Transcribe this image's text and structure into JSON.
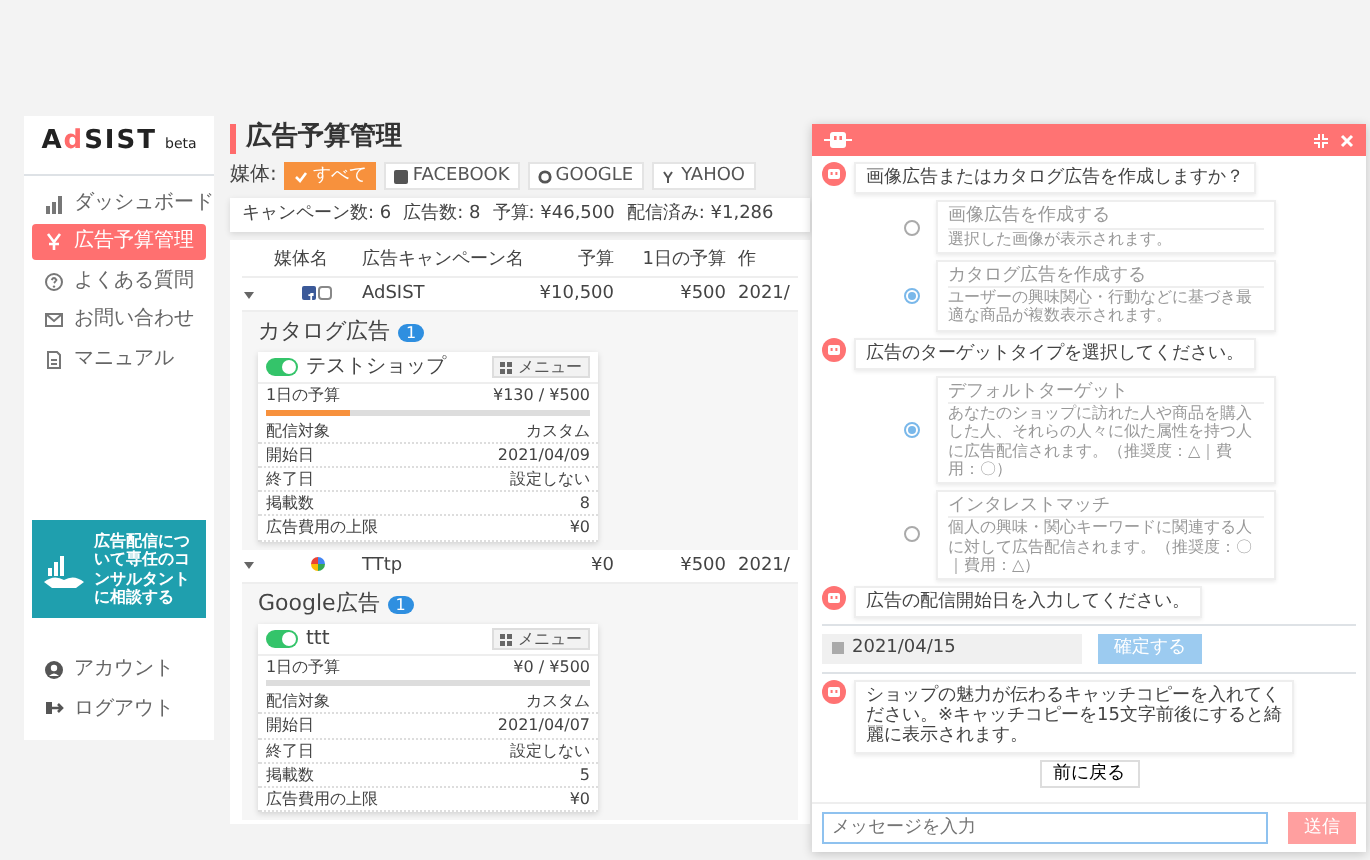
{
  "sidebar": {
    "logo": "AdSIST",
    "logo_suffix": "beta",
    "items": [
      {
        "label": "ダッシュボード",
        "selected": false
      },
      {
        "label": "広告予算管理",
        "selected": true
      },
      {
        "label": "よくある質問",
        "selected": false
      },
      {
        "label": "お問い合わせ",
        "selected": false
      },
      {
        "label": "マニュアル",
        "selected": false
      }
    ],
    "banner": {
      "text": "広告配信について専任のコンサルタントに相談する"
    },
    "bottom_items": [
      {
        "label": "アカウント"
      },
      {
        "label": "ログアウト"
      }
    ]
  },
  "page": {
    "title": "広告予算管理"
  },
  "filter": {
    "label": "媒体:",
    "options": [
      {
        "label": "すべて",
        "selected": true
      },
      {
        "label": "FACEBOOK",
        "selected": false
      },
      {
        "label": "GOOGLE",
        "selected": false
      },
      {
        "label": "YAHOO",
        "selected": false
      }
    ]
  },
  "summary": [
    {
      "label": "キャンペーン数:",
      "value": "6"
    },
    {
      "label": "広告数:",
      "value": "8"
    },
    {
      "label": "予算:",
      "value": "¥46,500"
    },
    {
      "label": "配信済み:",
      "value": "¥1,286"
    }
  ],
  "table": {
    "columns": [
      "媒体名",
      "広告キャンペーン名",
      "予算",
      "1日の予算",
      "作"
    ],
    "rows": [
      {
        "expanded": true,
        "kind": "facebook",
        "name": "AdSIST",
        "budget": "¥10,500",
        "daily": "¥500",
        "created": "2021/",
        "detail": {
          "title": "カタログ広告",
          "count": "1",
          "card": {
            "on": true,
            "name": "テストショップ",
            "menu": "メニュー",
            "budget_label": "1日の予算",
            "budget_value": "¥130 / ¥500",
            "level": 0.26,
            "fields": [
              {
                "label": "配信対象",
                "value": "カスタム"
              },
              {
                "label": "開始日",
                "value": "2021/04/09"
              },
              {
                "label": "終了日",
                "value": "設定しない"
              },
              {
                "label": "掲載数",
                "value": "8"
              },
              {
                "label": "広告費用の上限",
                "value": "¥0"
              }
            ]
          }
        }
      },
      {
        "expanded": true,
        "kind": "google",
        "name": "TTtp",
        "budget": "¥0",
        "daily": "¥500",
        "created": "2021/",
        "detail": {
          "title": "Google広告",
          "count": "1",
          "card": {
            "on": true,
            "name": "ttt",
            "menu": "メニュー",
            "budget_label": "1日の予算",
            "budget_value": "¥0 / ¥500",
            "level": 0,
            "fields": [
              {
                "label": "配信対象",
                "value": "カスタム"
              },
              {
                "label": "開始日",
                "value": "2021/04/07"
              },
              {
                "label": "終了日",
                "value": "設定しない"
              },
              {
                "label": "掲載数",
                "value": "5"
              },
              {
                "label": "広告費用の上限",
                "value": "¥0"
              }
            ]
          }
        }
      }
    ]
  },
  "chat": {
    "messages": [
      {
        "kind": "bot",
        "text": "画像広告またはカタログ広告を作成しますか？"
      },
      {
        "kind": "options",
        "options": [
          {
            "title": "画像広告を作成する",
            "description": "選択した画像が表示されます。",
            "selected": false
          },
          {
            "title": "カタログ広告を作成する",
            "description": "ユーザーの興味関心・行動などに基づき最適な商品が複数表示されます。",
            "selected": true
          }
        ]
      },
      {
        "kind": "bot",
        "text": "広告のターゲットタイプを選択してください。"
      },
      {
        "kind": "options",
        "options": [
          {
            "title": "デフォルトターゲット",
            "description": "あなたのショップに訪れた人や商品を購入した人、それらの人々に似た属性を持つ人に広告配信されます。（推奨度：△｜費用：〇）",
            "selected": true
          },
          {
            "title": "インタレストマッチ",
            "description": "個人の興味・関心キーワードに関連する人に対して広告配信されます。（推奨度：〇｜費用：△）",
            "selected": false
          }
        ]
      },
      {
        "kind": "bot",
        "text": "広告の配信開始日を入力してください。"
      },
      {
        "kind": "date",
        "value": "2021/04/15",
        "button": "確定する"
      },
      {
        "kind": "bot",
        "text": "ショップの魅力が伝わるキャッチコピーを入れてください。※キャッチコピーを15文字前後にすると綺麗に表示されます。"
      },
      {
        "kind": "back",
        "button": "前に戻る"
      }
    ],
    "input": {
      "placeholder": "メッセージを入力"
    },
    "send": {
      "label": "送信",
      "disabled": true
    }
  }
}
